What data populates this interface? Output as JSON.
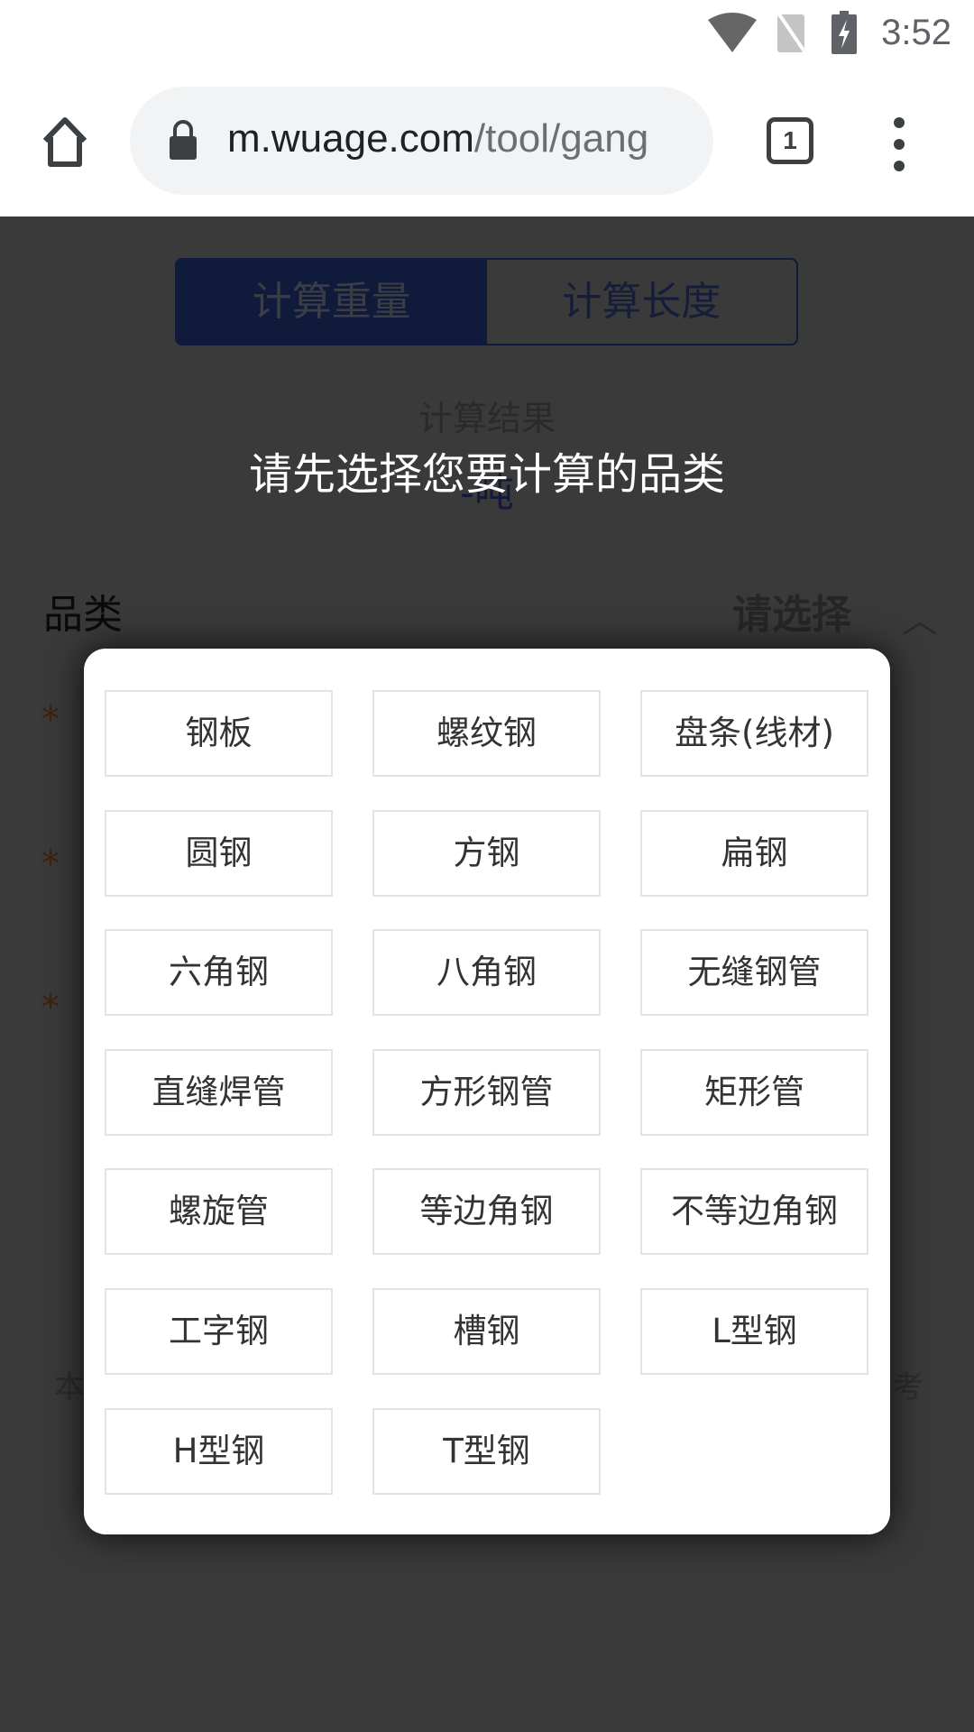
{
  "status_bar": {
    "time": "3:52",
    "icons": [
      "wifi-icon",
      "no-sim-icon",
      "battery-charging-icon"
    ]
  },
  "browser": {
    "url_domain": "m.wuage.com",
    "url_path": "/tool/gang",
    "tab_count": "1",
    "icons": [
      "home-icon",
      "lock-icon",
      "menu-icon"
    ]
  },
  "page": {
    "tabs": [
      {
        "label": "计算重量",
        "active": true
      },
      {
        "label": "计算长度",
        "active": false
      }
    ],
    "result_label": "计算结果",
    "result_value": "-吨",
    "category_label": "品类",
    "category_placeholder": "请选择",
    "required_mark": "*",
    "note_left": "本",
    "note_right": "考"
  },
  "toast": "请先选择您要计算的品类",
  "modal": {
    "options": [
      "钢板",
      "螺纹钢",
      "盘条(线材)",
      "圆钢",
      "方钢",
      "扁钢",
      "六角钢",
      "八角钢",
      "无缝钢管",
      "直缝焊管",
      "方形钢管",
      "矩形管",
      "螺旋管",
      "等边角钢",
      "不等边角钢",
      "工字钢",
      "槽钢",
      "L型钢",
      "H型钢",
      "T型钢"
    ]
  }
}
